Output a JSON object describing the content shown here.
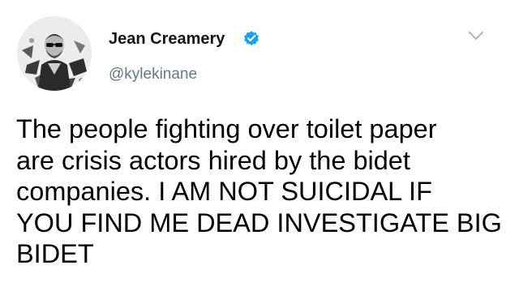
{
  "tweet": {
    "author": {
      "display_name": "Jean Creamery",
      "handle": "@kylekinane",
      "verified": true
    },
    "icons": {
      "verified": "verified-badge-icon",
      "menu": "chevron-down-icon",
      "avatar": "profile-photo"
    },
    "text": "The people fighting over toilet paper\nare crisis actors hired by the bidet\ncompanies. I AM NOT SUICIDAL IF\nYOU FIND ME DEAD INVESTIGATE BIG\nBIDET"
  },
  "colors": {
    "verified": "#1da1f2",
    "handle": "#657786",
    "caret": "#aab8c2",
    "text": "#000000"
  }
}
